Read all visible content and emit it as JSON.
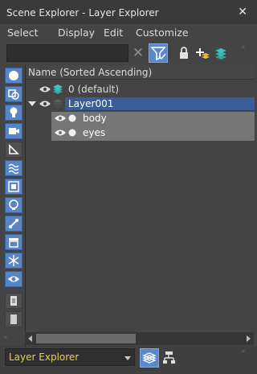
{
  "window": {
    "title": "Scene Explorer - Layer Explorer",
    "close_glyph": "✕"
  },
  "menu": [
    "Select",
    "Display",
    "Edit",
    "Customize"
  ],
  "toolbar": {
    "search_value": "",
    "clear_glyph": "✕",
    "filter_active": true,
    "icons": [
      "filter-icon",
      "lock-icon",
      "add-layer-icon",
      "layers-stack-icon"
    ]
  },
  "left_rail": {
    "buttons": [
      "sphere-icon",
      "shapes-icon",
      "light-bulb-icon",
      "camera-icon",
      "helper-ruler-icon",
      "spacewarp-icon",
      "group-icon",
      "xref-icon",
      "bone-icon",
      "container-icon",
      "frozen-icon",
      "hidden-eye-icon",
      "page-icon",
      "blank-icon"
    ]
  },
  "tree": {
    "header": "Name (Sorted Ascending)",
    "rows": [
      {
        "label": "0 (default)",
        "kind": "layer",
        "expanded": false,
        "selected": false,
        "eye_visible": true
      },
      {
        "label": "Layer001",
        "kind": "layer",
        "expanded": true,
        "selected": true,
        "eye_visible": true
      },
      {
        "label": "body",
        "kind": "object",
        "expanded": false,
        "selected": false,
        "eye_visible": true
      },
      {
        "label": "eyes",
        "kind": "object",
        "expanded": false,
        "selected": false,
        "eye_visible": true
      }
    ]
  },
  "bottom": {
    "explorer_name": "Layer Explorer",
    "buttons": [
      "layers-stack-icon",
      "hierarchy-icon"
    ]
  },
  "colors": {
    "accent_blue": "#5b88c8",
    "selected_row": "#3b5d97",
    "child_row": "#767676",
    "explorer_text": "#e8d14a",
    "layer_icon": "#3ec3c3"
  }
}
